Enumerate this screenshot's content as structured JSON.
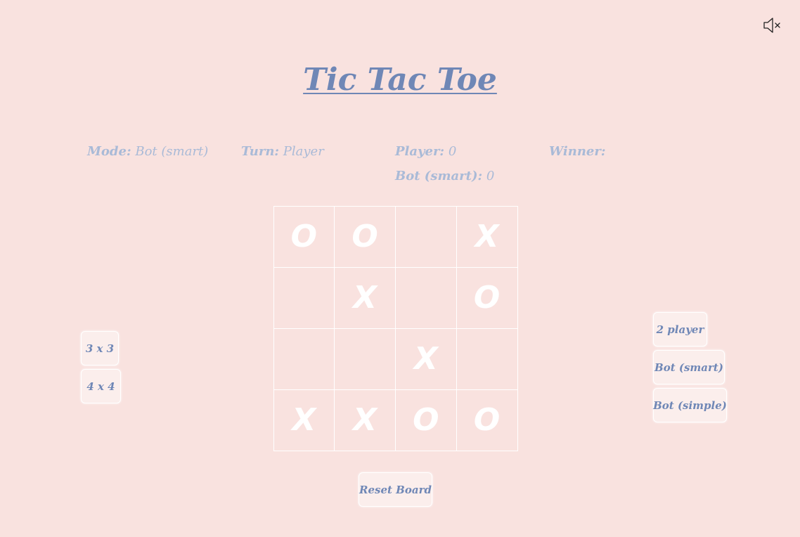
{
  "header": {
    "title": "Tic Tac Toe",
    "mute_icon": "speaker-muted-icon"
  },
  "status": {
    "mode_label": "Mode:",
    "mode_value": "Bot (smart)",
    "turn_label": "Turn:",
    "turn_value": "Player",
    "player_label": "Player:",
    "player_score": "0",
    "bot_label": "Bot (smart):",
    "bot_score": "0",
    "winner_label": "Winner:",
    "winner_value": ""
  },
  "board": {
    "size": 4,
    "cells": [
      "O",
      "O",
      "",
      "X",
      "",
      "X",
      "",
      "O",
      "",
      "",
      "X",
      "",
      "X",
      "X",
      "O",
      "O"
    ]
  },
  "size_buttons": [
    "3 x 3",
    "4 x 4"
  ],
  "mode_buttons": [
    "2 player",
    "Bot (smart)",
    "Bot (simple)"
  ],
  "reset_label": "Reset Board",
  "colors": {
    "background": "#f9e2df",
    "accent": "#6f87b6",
    "muted": "#a9bad7",
    "mark": "#ffffff"
  }
}
